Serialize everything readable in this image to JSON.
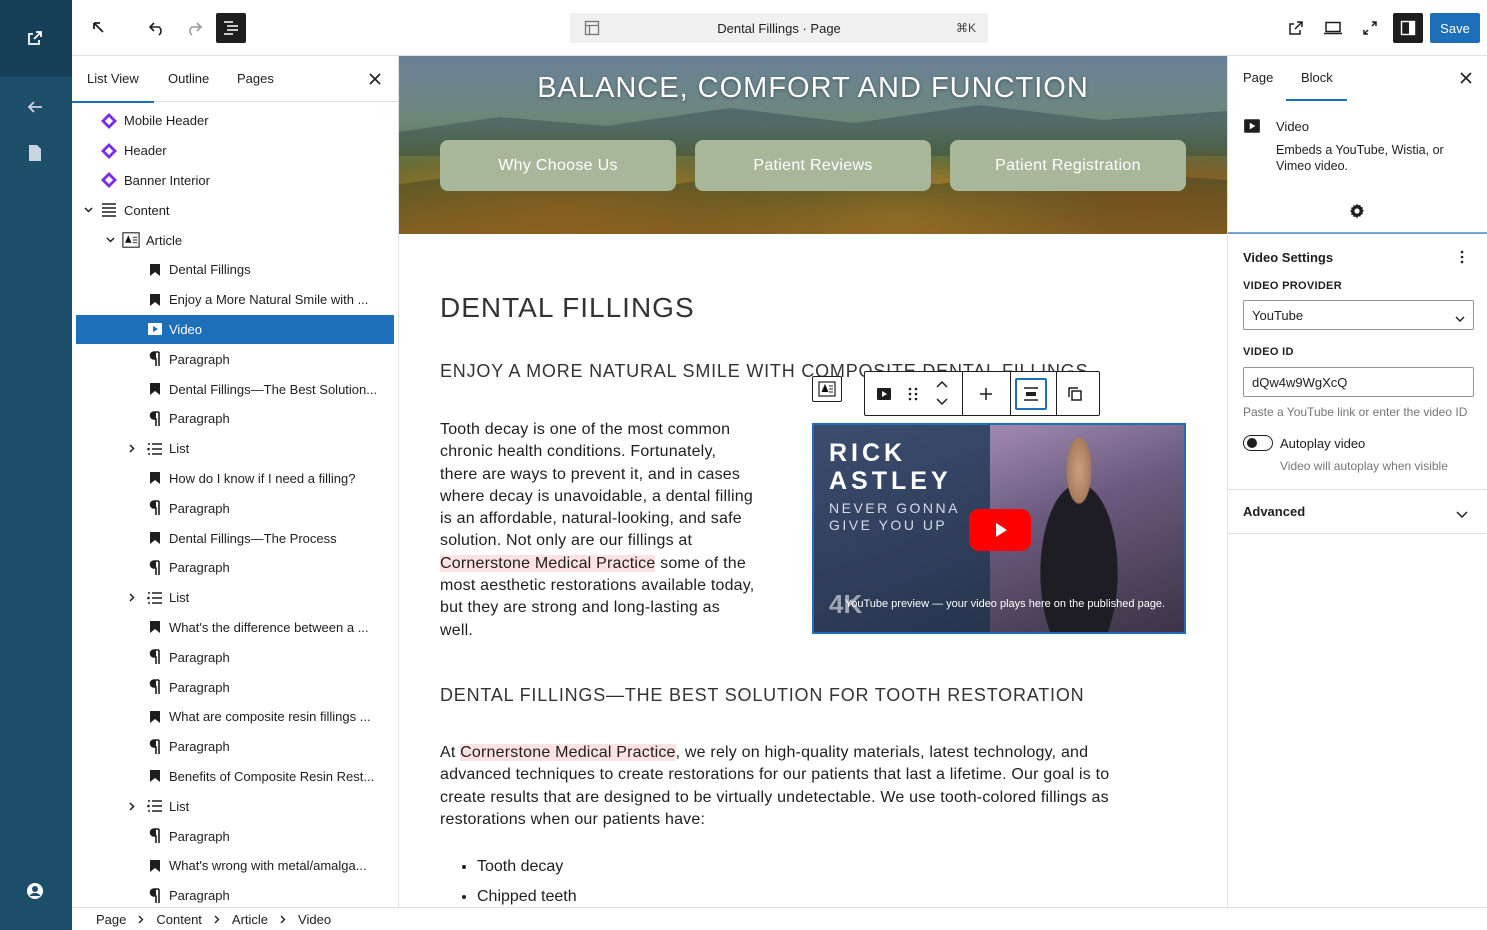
{
  "topbar": {
    "document_title": "Dental Fillings · Page",
    "shortcut": "⌘K",
    "save_label": "Save"
  },
  "left_panel": {
    "tabs": [
      {
        "label": "List View",
        "active": true
      },
      {
        "label": "Outline",
        "active": false
      },
      {
        "label": "Pages",
        "active": false
      }
    ],
    "tree": [
      {
        "label": "Mobile Header",
        "icon": "template-part-icon",
        "depth": 0,
        "expander": "none"
      },
      {
        "label": "Header",
        "icon": "template-part-icon",
        "depth": 0,
        "expander": "none"
      },
      {
        "label": "Banner Interior",
        "icon": "template-part-icon",
        "depth": 0,
        "expander": "none"
      },
      {
        "label": "Content",
        "icon": "content-icon",
        "depth": 0,
        "expander": "open"
      },
      {
        "label": "Article",
        "icon": "article-icon",
        "depth": 1,
        "expander": "open"
      },
      {
        "label": "Dental Fillings",
        "icon": "heading-bookmark-icon",
        "depth": 2,
        "expander": "none"
      },
      {
        "label": "Enjoy a More Natural Smile with ...",
        "icon": "heading-bookmark-icon",
        "depth": 2,
        "expander": "none"
      },
      {
        "label": "Video",
        "icon": "video-icon",
        "depth": 2,
        "expander": "none",
        "selected": true
      },
      {
        "label": "Paragraph",
        "icon": "paragraph-icon",
        "depth": 2,
        "expander": "none"
      },
      {
        "label": "Dental Fillings—The Best Solution...",
        "icon": "heading-bookmark-icon",
        "depth": 2,
        "expander": "none"
      },
      {
        "label": "Paragraph",
        "icon": "paragraph-icon",
        "depth": 2,
        "expander": "none"
      },
      {
        "label": "List",
        "icon": "list-icon",
        "depth": 2,
        "expander": "closed"
      },
      {
        "label": "How do I know if I need a filling?",
        "icon": "heading-bookmark-icon",
        "depth": 2,
        "expander": "none"
      },
      {
        "label": "Paragraph",
        "icon": "paragraph-icon",
        "depth": 2,
        "expander": "none"
      },
      {
        "label": "Dental Fillings—The Process",
        "icon": "heading-bookmark-icon",
        "depth": 2,
        "expander": "none"
      },
      {
        "label": "Paragraph",
        "icon": "paragraph-icon",
        "depth": 2,
        "expander": "none"
      },
      {
        "label": "List",
        "icon": "list-icon",
        "depth": 2,
        "expander": "closed"
      },
      {
        "label": "What's the difference between a ...",
        "icon": "heading-bookmark-icon",
        "depth": 2,
        "expander": "none"
      },
      {
        "label": "Paragraph",
        "icon": "paragraph-icon",
        "depth": 2,
        "expander": "none"
      },
      {
        "label": "Paragraph",
        "icon": "paragraph-icon",
        "depth": 2,
        "expander": "none"
      },
      {
        "label": "What are composite resin fillings ...",
        "icon": "heading-bookmark-icon",
        "depth": 2,
        "expander": "none"
      },
      {
        "label": "Paragraph",
        "icon": "paragraph-icon",
        "depth": 2,
        "expander": "none"
      },
      {
        "label": "Benefits of Composite Resin Rest...",
        "icon": "heading-bookmark-icon",
        "depth": 2,
        "expander": "none"
      },
      {
        "label": "List",
        "icon": "list-icon",
        "depth": 2,
        "expander": "closed"
      },
      {
        "label": "Paragraph",
        "icon": "paragraph-icon",
        "depth": 2,
        "expander": "none"
      },
      {
        "label": "What's wrong with metal/amalga...",
        "icon": "heading-bookmark-icon",
        "depth": 2,
        "expander": "none"
      },
      {
        "label": "Paragraph",
        "icon": "paragraph-icon",
        "depth": 2,
        "expander": "none"
      }
    ]
  },
  "breadcrumb": [
    "Page",
    "Content",
    "Article",
    "Video"
  ],
  "canvas": {
    "banner_title": "BALANCE, COMFORT AND FUNCTION",
    "buttons": [
      "Why Choose Us",
      "Patient Reviews",
      "Patient Registration"
    ],
    "heading1": "DENTAL FILLINGS",
    "heading2a": "ENJOY A MORE NATURAL SMILE WITH COMPOSITE DENTAL FILLINGS",
    "para1_lines": [
      "Tooth decay is one of the most common",
      "chronic health conditions. Fortunately,",
      "there are ways to prevent it, and in cases",
      "where decay is unavoidable, a dental filling",
      "is an affordable, natural-looking, and safe",
      "solution. Not only are our fillings at"
    ],
    "para1_highlight": "Cornerstone Medical Practice",
    "para1_after_highlight": " some of the",
    "para1_tail_lines": [
      "most aesthetic restorations available today,",
      "but they are strong and long-lasting as",
      "well."
    ],
    "heading2b": "DENTAL FILLINGS—THE BEST SOLUTION FOR TOOTH RESTORATION",
    "para2_prefix": "At ",
    "para2_highlight": "Cornerstone Medical Practice",
    "para2_line1_rest": ", we rely on high-quality materials, latest technology, and",
    "para2_lines": [
      "advanced techniques to create restorations for our patients that last a lifetime. Our goal is to",
      "create results that are designed to be virtually undetectable. We use tooth-colored fillings as",
      "restorations when our patients have:"
    ],
    "bullets": [
      "Tooth decay",
      "Chipped teeth"
    ],
    "video": {
      "artist_line1": "RICK",
      "artist_line2": "ASTLEY",
      "song_line1": "NEVER GONNA",
      "song_line2": "GIVE YOU UP",
      "badge": "4K",
      "caption": "YouTube preview — your video plays here on the published page."
    }
  },
  "right_panel": {
    "tabs": [
      {
        "label": "Page",
        "active": false
      },
      {
        "label": "Block",
        "active": true
      }
    ],
    "block_name": "Video",
    "block_description": "Embeds a YouTube, Wistia, or Vimeo video.",
    "section_title": "Video Settings",
    "provider_label": "VIDEO PROVIDER",
    "provider_value": "YouTube",
    "video_id_label": "VIDEO ID",
    "video_id_value": "dQw4w9WgXcQ",
    "video_id_help": "Paste a YouTube link or enter the video ID",
    "autoplay_label": "Autoplay video",
    "autoplay_help": "Video will autoplay when visible",
    "autoplay_on": false,
    "advanced_label": "Advanced"
  },
  "colors": {
    "accent": "#1c6fb8",
    "rail": "#1d4f6b",
    "pill": "#a8b69a",
    "highlight": "#fde2e4"
  }
}
